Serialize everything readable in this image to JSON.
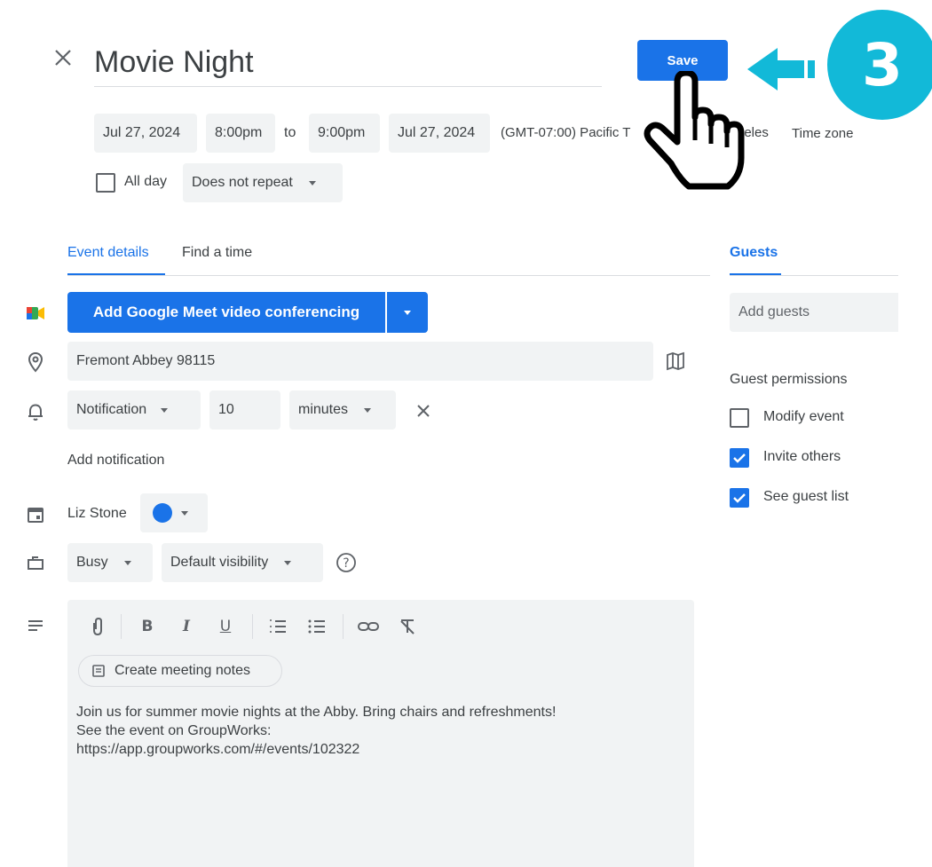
{
  "header": {
    "title": "Movie Night",
    "save_label": "Save",
    "step_number": "3"
  },
  "datetime": {
    "start_date": "Jul 27, 2024",
    "start_time": "8:00pm",
    "to": "to",
    "end_time": "9:00pm",
    "end_date": "Jul 27, 2024",
    "timezone_text": "(GMT-07:00) Pacific T",
    "timezone_trailing": "geles",
    "timezone_link": "Time zone"
  },
  "options": {
    "all_day": "All day",
    "repeat": "Does not repeat"
  },
  "tabs": {
    "event_details": "Event details",
    "find_a_time": "Find a time",
    "guests": "Guests"
  },
  "details": {
    "meet_label": "Add Google Meet video conferencing",
    "location": "Fremont Abbey 98115",
    "notification_type": "Notification",
    "notification_value": "10",
    "notification_unit": "minutes",
    "add_notification": "Add notification",
    "calendar_owner": "Liz Stone",
    "calendar_color": "#1a73e8",
    "busy": "Busy",
    "visibility": "Default visibility",
    "meeting_notes": "Create meeting notes",
    "description": [
      "Join us for summer movie nights at the Abby. Bring chairs and refreshments!",
      "See the event on GroupWorks:",
      "https://app.groupworks.com/#/events/102322"
    ]
  },
  "guests": {
    "placeholder": "Add guests",
    "permissions_title": "Guest permissions",
    "permissions": [
      {
        "label": "Modify event",
        "checked": false
      },
      {
        "label": "Invite others",
        "checked": true
      },
      {
        "label": "See guest list",
        "checked": true
      }
    ]
  },
  "colors": {
    "accent": "#1a73e8",
    "step_badge": "#12b9d8",
    "field_bg": "#f1f3f4"
  }
}
